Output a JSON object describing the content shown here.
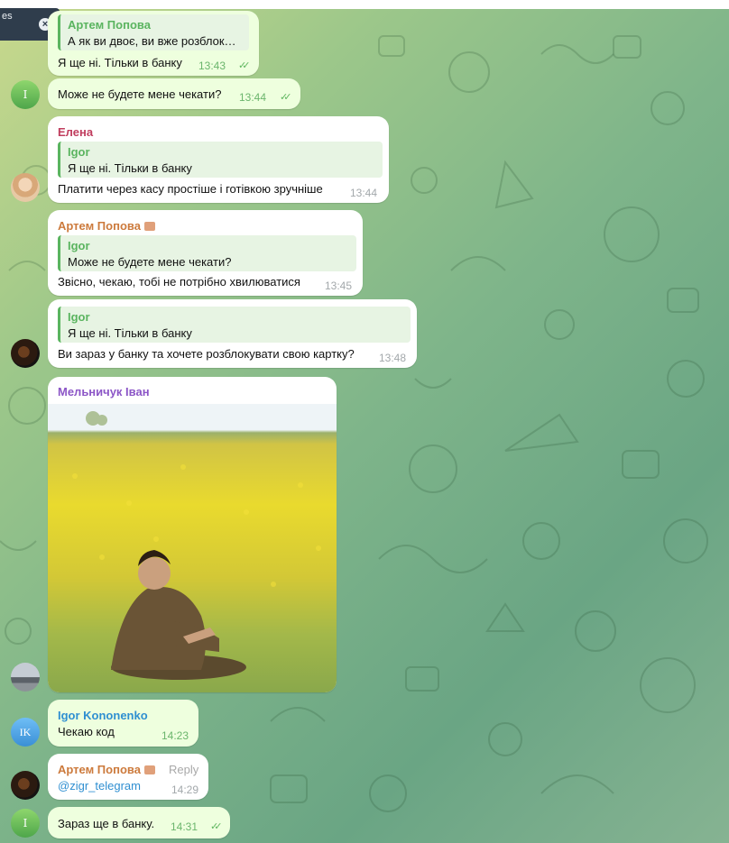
{
  "tooltip": {
    "text": "es",
    "close_icon": "close-icon"
  },
  "messages": [
    {
      "id": "m1",
      "reply": {
        "name": "Артем Попова",
        "text": "А як ви двоє, ви вже розблок…"
      },
      "text": "Я ще ні. Тільки в банку",
      "time": "13:43",
      "checks": "✓✓"
    },
    {
      "id": "m2",
      "avatar_letter": "I",
      "text": "Може не будете мене чекати?",
      "time": "13:44",
      "checks": "✓✓"
    },
    {
      "id": "m3",
      "sender": "Елена",
      "sender_color": "#c03d5e",
      "reply": {
        "name": "Igor",
        "text": "Я ще ні. Тільки в банку"
      },
      "text": "Платити через касу простіше і готівкою зручніше",
      "time": "13:44"
    },
    {
      "id": "m4",
      "sender": "Артем Попова",
      "sender_color": "#cc7a3c",
      "reply": {
        "name": "Igor",
        "text": "Може не будете мене чекати?"
      },
      "text": "Звісно, чекаю, тобі не потрібно хвилюватися",
      "time": "13:45"
    },
    {
      "id": "m5",
      "reply": {
        "name": "Igor",
        "text": "Я ще ні. Тільки в банку"
      },
      "text": "Ви зараз у банку та хочете розблокувати свою картку?",
      "time": "13:48"
    },
    {
      "id": "m6",
      "sender": "Мельничук Іван",
      "sender_color": "#8c56c7",
      "photo": "man-sitting-in-yellow-field"
    },
    {
      "id": "m7",
      "avatar_letter": "IK",
      "sender": "Igor Kononenko",
      "sender_color": "#2f8fd1",
      "text": "Чекаю код",
      "time": "14:23"
    },
    {
      "id": "m8",
      "sender": "Артем Попова",
      "sender_color": "#cc7a3c",
      "reply_label": "Reply",
      "text": "@zigr_telegram",
      "time": "14:29"
    },
    {
      "id": "m9",
      "avatar_letter": "I",
      "text": "Зараз ще в банку.",
      "time": "14:31",
      "checks": "✓✓"
    }
  ],
  "colors": {
    "accent_green": "#5ab45f",
    "outgoing_bubble": "#eeffde",
    "incoming_bubble": "#ffffff"
  }
}
